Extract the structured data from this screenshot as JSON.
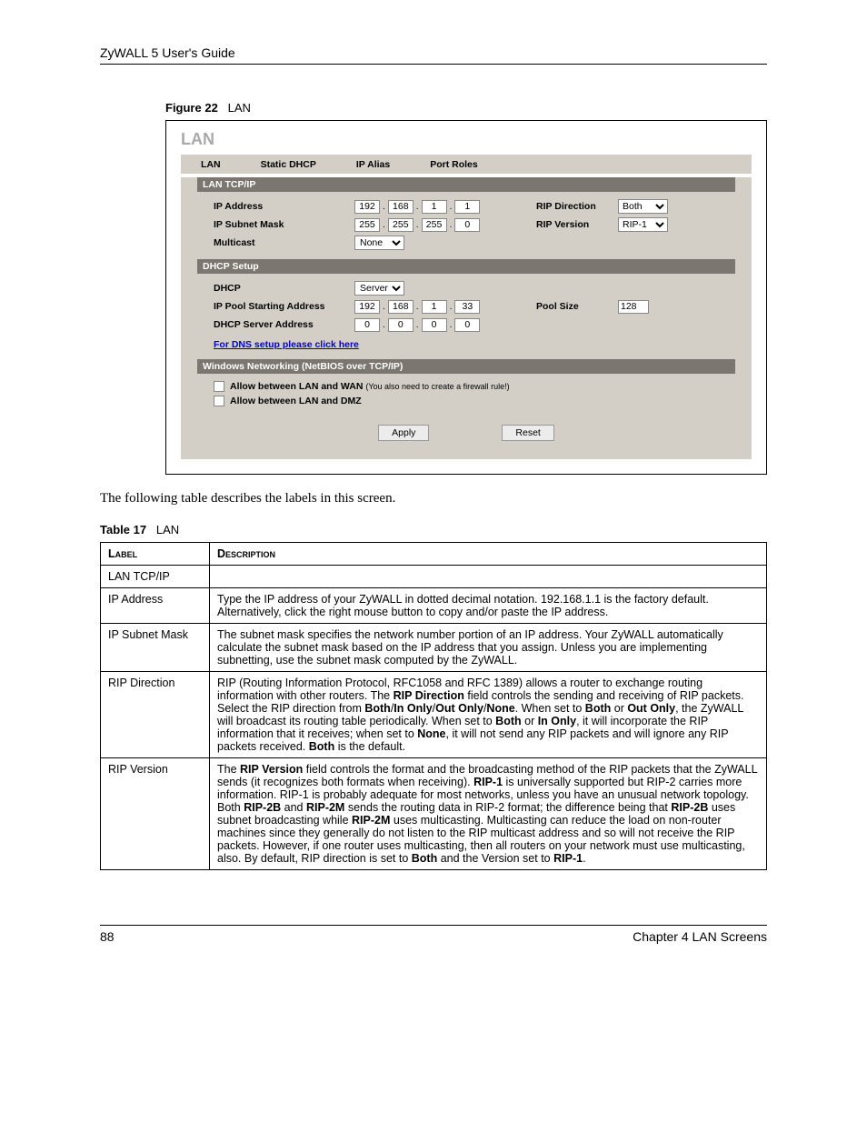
{
  "header": {
    "guide_title": "ZyWALL 5 User's Guide"
  },
  "figure": {
    "label": "Figure 22",
    "title": "LAN"
  },
  "screenshot": {
    "page_heading": "LAN",
    "tabs": {
      "lan": "LAN",
      "static_dhcp": "Static DHCP",
      "ip_alias": "IP Alias",
      "port_roles": "Port Roles"
    },
    "sections": {
      "tcpip_bar": "LAN TCP/IP",
      "dhcp_bar": "DHCP Setup",
      "netbios_bar": "Windows Networking (NetBIOS over TCP/IP)"
    },
    "fields": {
      "ip_address_label": "IP Address",
      "ip_address": {
        "a": "192",
        "b": "168",
        "c": "1",
        "d": "1"
      },
      "subnet_label": "IP Subnet Mask",
      "subnet": {
        "a": "255",
        "b": "255",
        "c": "255",
        "d": "0"
      },
      "multicast_label": "Multicast",
      "multicast_value": "None",
      "rip_dir_label": "RIP Direction",
      "rip_dir_value": "Both",
      "rip_ver_label": "RIP Version",
      "rip_ver_value": "RIP-1",
      "dhcp_label": "DHCP",
      "dhcp_value": "Server",
      "pool_start_label": "IP Pool Starting Address",
      "pool_start": {
        "a": "192",
        "b": "168",
        "c": "1",
        "d": "33"
      },
      "pool_size_label": "Pool Size",
      "pool_size_value": "128",
      "dhcp_server_label": "DHCP Server Address",
      "dhcp_server": {
        "a": "0",
        "b": "0",
        "c": "0",
        "d": "0"
      },
      "dns_link": "For DNS setup please click here",
      "allow_wan_label": "Allow between LAN and WAN",
      "allow_wan_note": "(You also need to create a firewall rule!)",
      "allow_dmz_label": "Allow between LAN and DMZ",
      "apply_btn": "Apply",
      "reset_btn": "Reset"
    }
  },
  "intro": "The following table describes the labels in this screen.",
  "table": {
    "caption_label": "Table 17",
    "caption_title": "LAN",
    "header": {
      "label": "Label",
      "description": "Description"
    },
    "rows": [
      {
        "label": "LAN TCP/IP",
        "desc": ""
      },
      {
        "label": "IP Address",
        "desc": "Type the IP address of your ZyWALL in dotted decimal notation. 192.168.1.1 is the factory default. Alternatively, click the right mouse button to copy and/or paste the IP address."
      },
      {
        "label": "IP Subnet Mask",
        "desc": "The subnet mask specifies the network number portion of an IP address. Your ZyWALL automatically calculate the subnet mask based on the IP address that you assign. Unless you are implementing subnetting, use the subnet mask computed by the ZyWALL."
      },
      {
        "label": "RIP Direction",
        "desc_html": "RIP (Routing Information Protocol, RFC1058 and RFC 1389) allows a router to exchange routing information with other routers. The <b>RIP Direction</b> field controls the sending and receiving of RIP packets. Select the RIP direction from <b>Both</b>/<b>In Only</b>/<b>Out Only</b>/<b>None</b>. When set to <b>Both</b> or <b>Out Only</b>, the ZyWALL will broadcast its routing table periodically. When set to <b>Both</b> or <b>In Only</b>, it will incorporate the RIP information that it receives; when set to <b>None</b>, it will not send any RIP packets and will ignore any RIP packets received. <b>Both</b> is the default."
      },
      {
        "label": "RIP Version",
        "desc_html": "The <b>RIP Version</b> field controls the format and the broadcasting method of the RIP packets that the ZyWALL sends (it recognizes both formats when receiving). <b>RIP-1</b> is universally supported but RIP-2 carries more information. RIP-1 is probably adequate for most networks, unless you have an unusual network topology. Both <b>RIP-2B</b> and <b>RIP-2M</b> sends the routing data in RIP-2 format; the difference being that <b>RIP-2B</b> uses subnet broadcasting while <b>RIP-2M</b> uses multicasting. Multicasting can reduce the load on non-router machines since they generally do not listen to the RIP multicast address and so will not receive the RIP packets. However, if one router uses multicasting, then all routers on your network must use multicasting, also. By default, RIP direction is set to <b>Both</b> and the Version set to <b>RIP-1</b>."
      }
    ]
  },
  "footer": {
    "page_number": "88",
    "chapter": "Chapter 4 LAN Screens"
  }
}
